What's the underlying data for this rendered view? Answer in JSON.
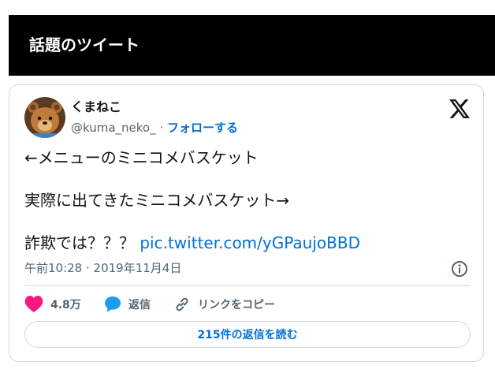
{
  "banner": {
    "title": "話題のツイート"
  },
  "tweet": {
    "display_name": "くまねこ",
    "handle": "@kuma_neko_",
    "separator": "·",
    "follow_label": "フォローする",
    "lines": [
      "←メニューのミニコメバスケット",
      "実際に出てきたミニコメバスケット→",
      "詐欺では？？？"
    ],
    "link": "pic.twitter.com/yGPaujoBBD",
    "timestamp": "午前10:28 · 2019年11月4日"
  },
  "actions": {
    "likes": "4.8万",
    "reply_label": "返信",
    "copy_link_label": "リンクをコピー"
  },
  "read_replies_label": "215件の返信を読む",
  "colors": {
    "like": "#f91880",
    "reply": "#1d9bf0",
    "link": "#006fd6",
    "muted": "#536471"
  },
  "icons": [
    "x-logo-icon",
    "info-icon",
    "heart-icon",
    "reply-bubble-icon",
    "link-icon"
  ]
}
